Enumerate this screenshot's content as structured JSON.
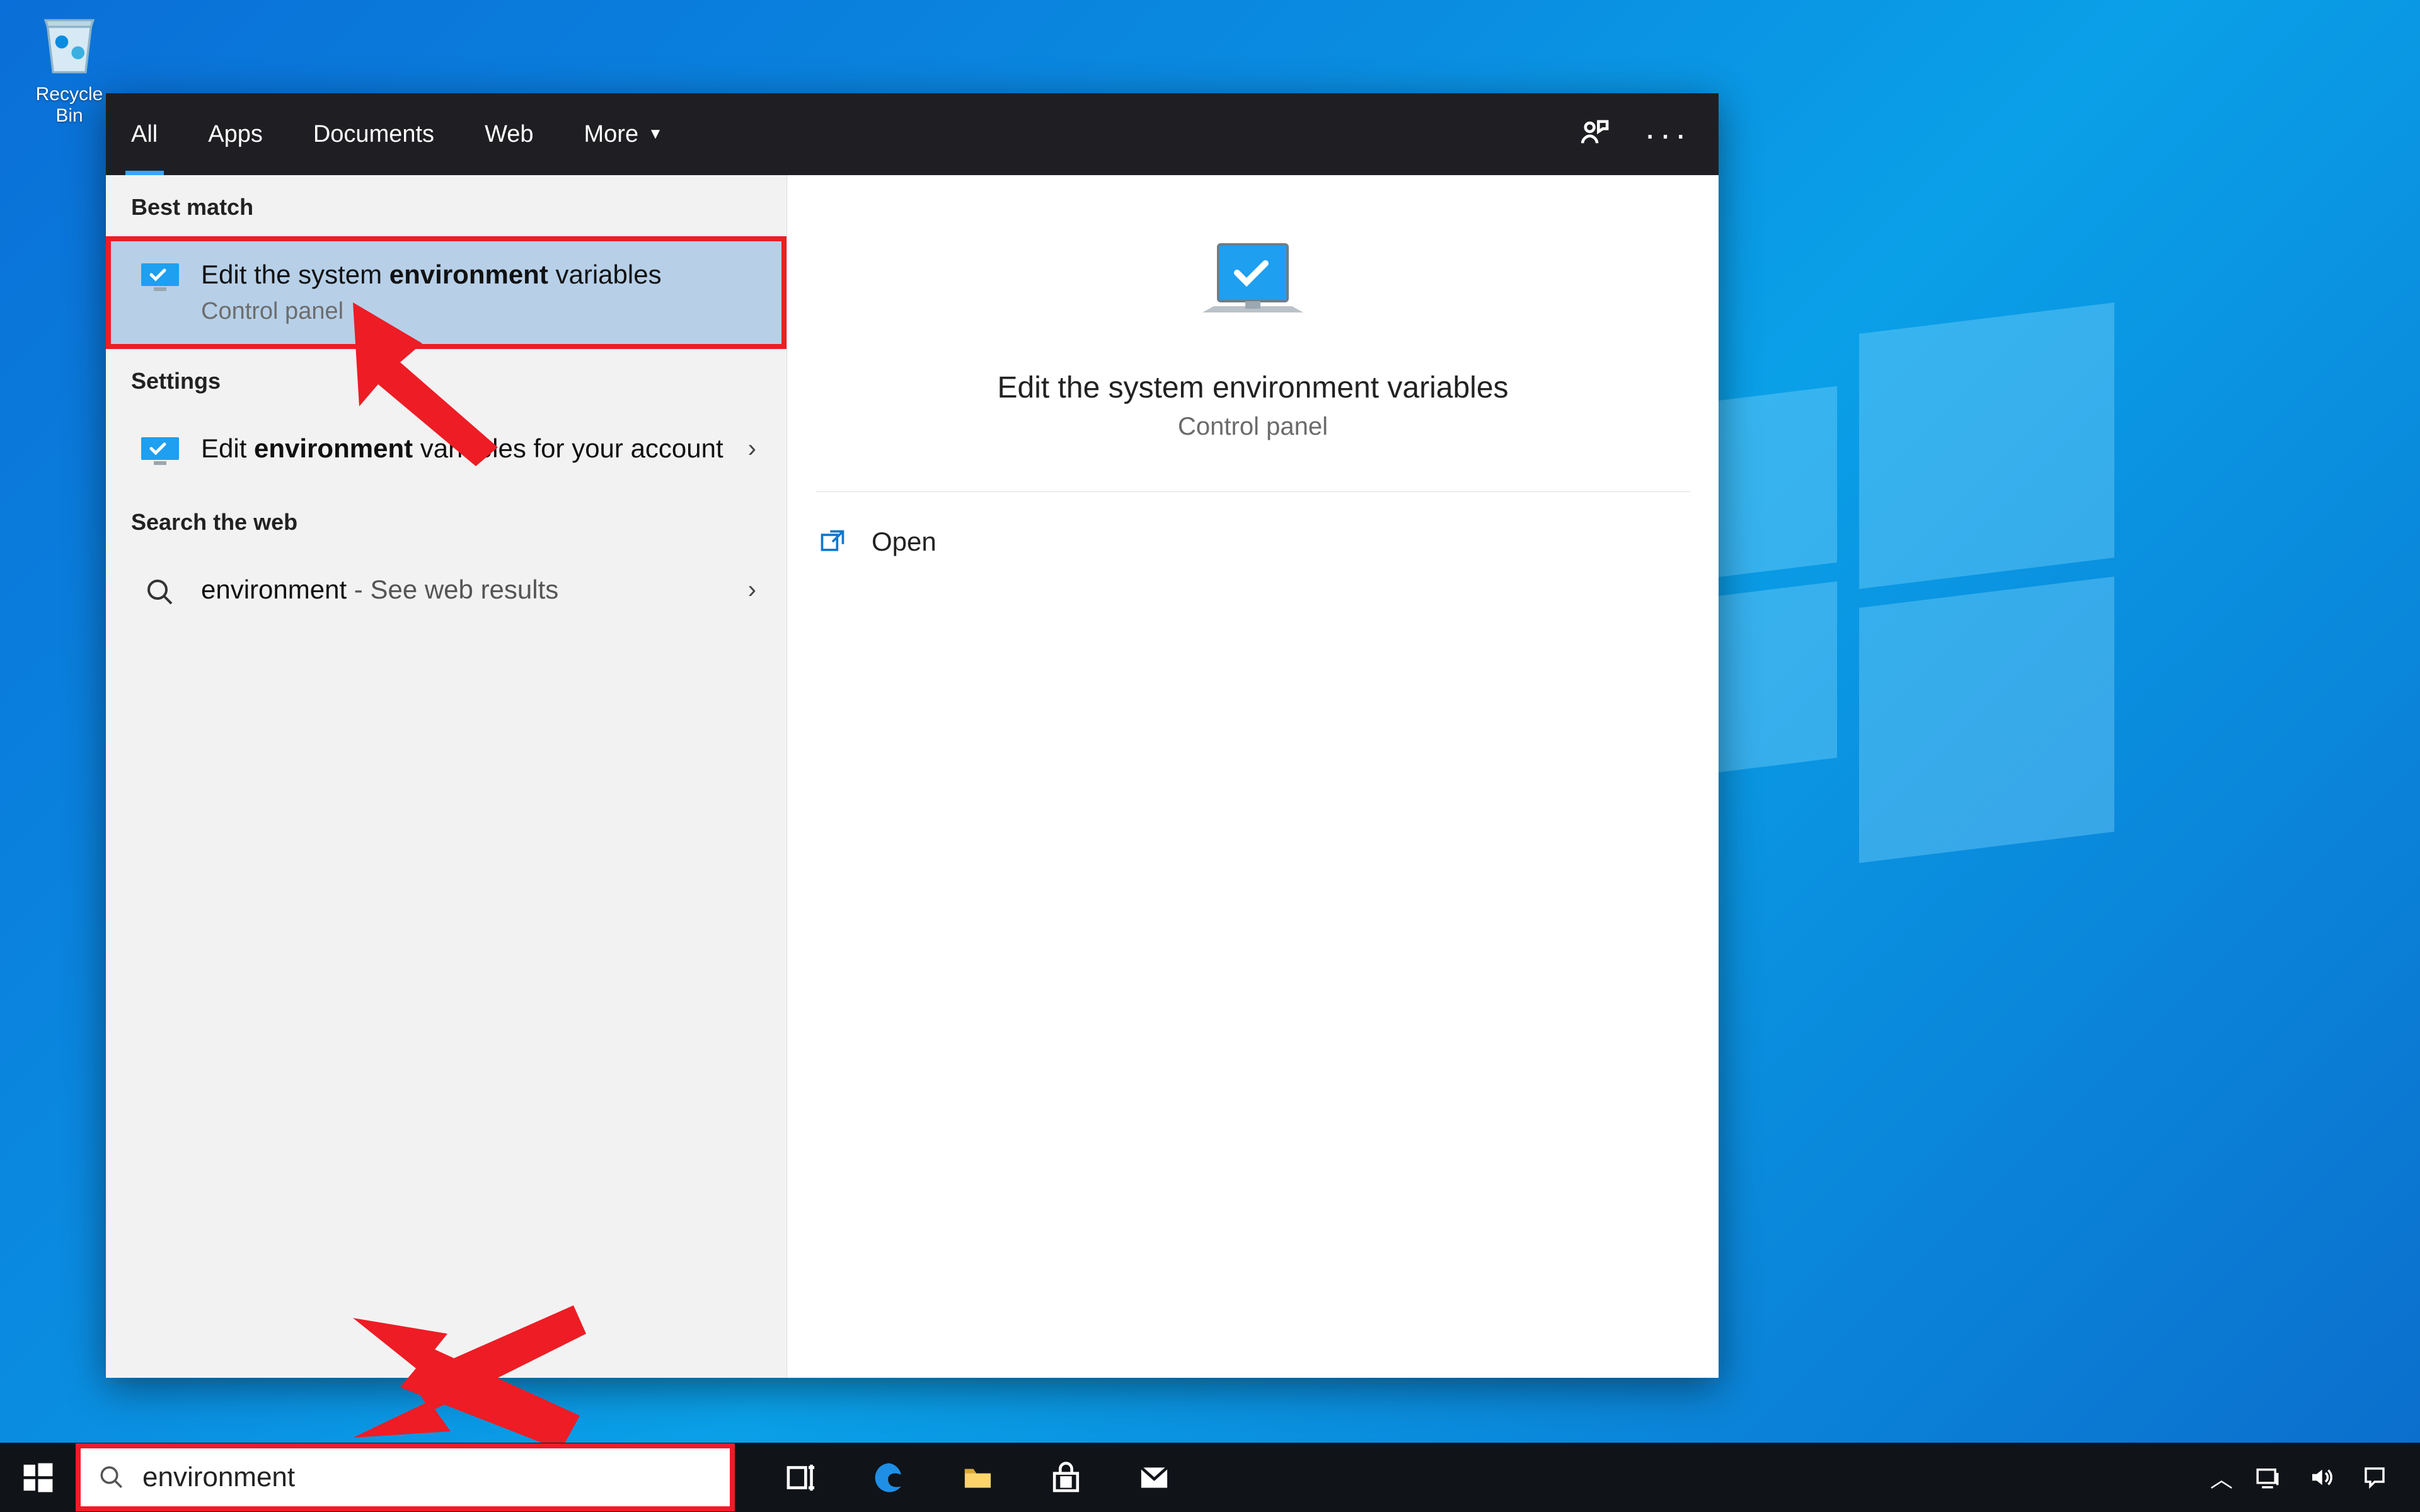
{
  "desktop": {
    "recycle_bin_label": "Recycle Bin"
  },
  "search_panel": {
    "tabs": {
      "all": "All",
      "apps": "Apps",
      "documents": "Documents",
      "web": "Web",
      "more": "More"
    },
    "headers": {
      "best_match": "Best match",
      "settings": "Settings",
      "search_web": "Search the web"
    },
    "results": {
      "best_match": {
        "pre": "Edit the system ",
        "bold": "environment",
        "post": " variables",
        "sub": "Control panel"
      },
      "settings_item": {
        "pre": "Edit ",
        "bold": "environment",
        "post": " variables for your account"
      },
      "web_item": {
        "term": "environment",
        "suffix": " - See web results"
      }
    },
    "preview": {
      "title": "Edit the system environment variables",
      "sub": "Control panel",
      "open": "Open"
    }
  },
  "taskbar": {
    "search_query": "environment"
  }
}
